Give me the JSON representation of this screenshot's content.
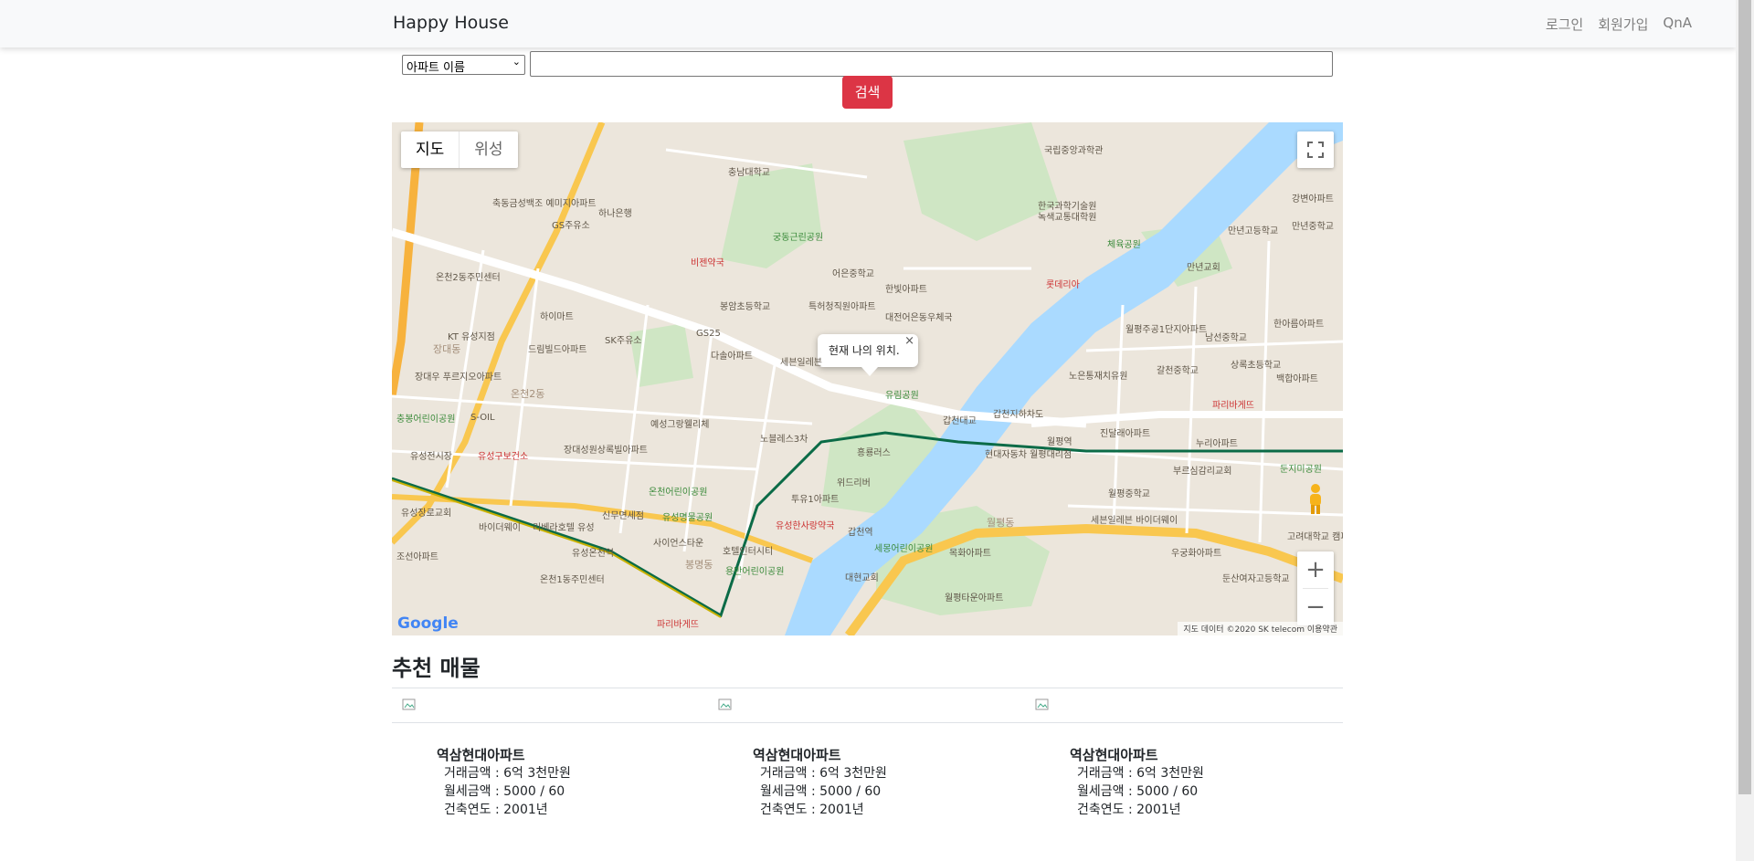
{
  "navbar": {
    "brand": "Happy House",
    "links": [
      "로그인",
      "회원가입",
      "QnA"
    ]
  },
  "search": {
    "select_value": "아파트 이름",
    "input_value": "",
    "button_label": "검색"
  },
  "map": {
    "type_controls": [
      "지도",
      "위성"
    ],
    "infowindow_text": "현재 나의 위치.",
    "attribution": "지도 데이터 ©2020 SK telecom    이용약관",
    "google_logo": "Google",
    "zoom_in": "+",
    "zoom_out": "−",
    "labels": [
      "충남대학교",
      "궁동근린공원",
      "비젠약국",
      "어은중학교",
      "한빛아파트",
      "대전어은동우체국",
      "봉암초등학교",
      "특허청직원아파트",
      "다솔아파트",
      "세븐일레븐",
      "GS주유소",
      "GS25",
      "SK주유소",
      "드림빌드아파트",
      "KT 유성지점",
      "장대동",
      "온천2동",
      "S-OIL",
      "충봉어린이공원",
      "유성구보건소",
      "장대성원상록빌아파트",
      "예성그랑웰리체",
      "노블레스3차",
      "흥룡러스",
      "위드리버",
      "투유1아파트",
      "온천어린이공원",
      "신무면세점",
      "유성명물공원",
      "유성한사랑약국",
      "사이언스타운",
      "호텔인터시티",
      "봉명동",
      "용반어린이공원",
      "유성온천역",
      "온천1동주민센터",
      "파리바게뜨",
      "유림공원",
      "갑천대교",
      "갑천지하차도",
      "월평역",
      "현대자동차 월평대리점",
      "갑천역",
      "세몽어린이공원",
      "목화아파트",
      "대현교회",
      "월평타운아파트",
      "월평동",
      "국립중앙과학관",
      "한국과학기술원",
      "녹색교통대학원",
      "체육공원",
      "롯데리아",
      "월평주공1단지아파트",
      "남선중학교",
      "노은통재치유원",
      "갈천중학교",
      "상록초등학교",
      "백합아파트",
      "파리바게뜨",
      "진달래아파트",
      "누리아파트",
      "부르심감리교회",
      "둔지미공원",
      "월평중학교",
      "세븐일레븐 바이더웨이",
      "우궁화아파트",
      "둔산여자고등학교",
      "고려대학교 캠퍼스",
      "만년고등학교",
      "강변아파트",
      "만년교회",
      "한아름아파트",
      "유성장로교회",
      "바이더웨이",
      "리베라호텔 유성",
      "조선아파트",
      "온천2동주민센터",
      "하나은행",
      "축동금성백조 예미지아파트",
      "하이마트",
      "장대우 푸르지오아파트",
      "유성전시장",
      "만년중학교"
    ]
  },
  "recommend": {
    "title": "추천 매물",
    "cards": [
      {
        "name": "역삼현대아파트",
        "price": "거래금액 : 6억 3천만원",
        "rent": "월세금액 : 5000 / 60",
        "year": "건축연도 : 2001년"
      },
      {
        "name": "역삼현대아파트",
        "price": "거래금액 : 6억 3천만원",
        "rent": "월세금액 : 5000 / 60",
        "year": "건축연도 : 2001년"
      },
      {
        "name": "역삼현대아파트",
        "price": "거래금액 : 6억 3천만원",
        "rent": "월세금액 : 5000 / 60",
        "year": "건축연도 : 2001년"
      }
    ]
  },
  "colors": {
    "accent": "#dc3545",
    "navbar_bg": "#f8f9fa",
    "river": "#aadaff",
    "park": "#c5e8c5",
    "road_major": "#f9c74f",
    "subway": "#0b6b47"
  }
}
